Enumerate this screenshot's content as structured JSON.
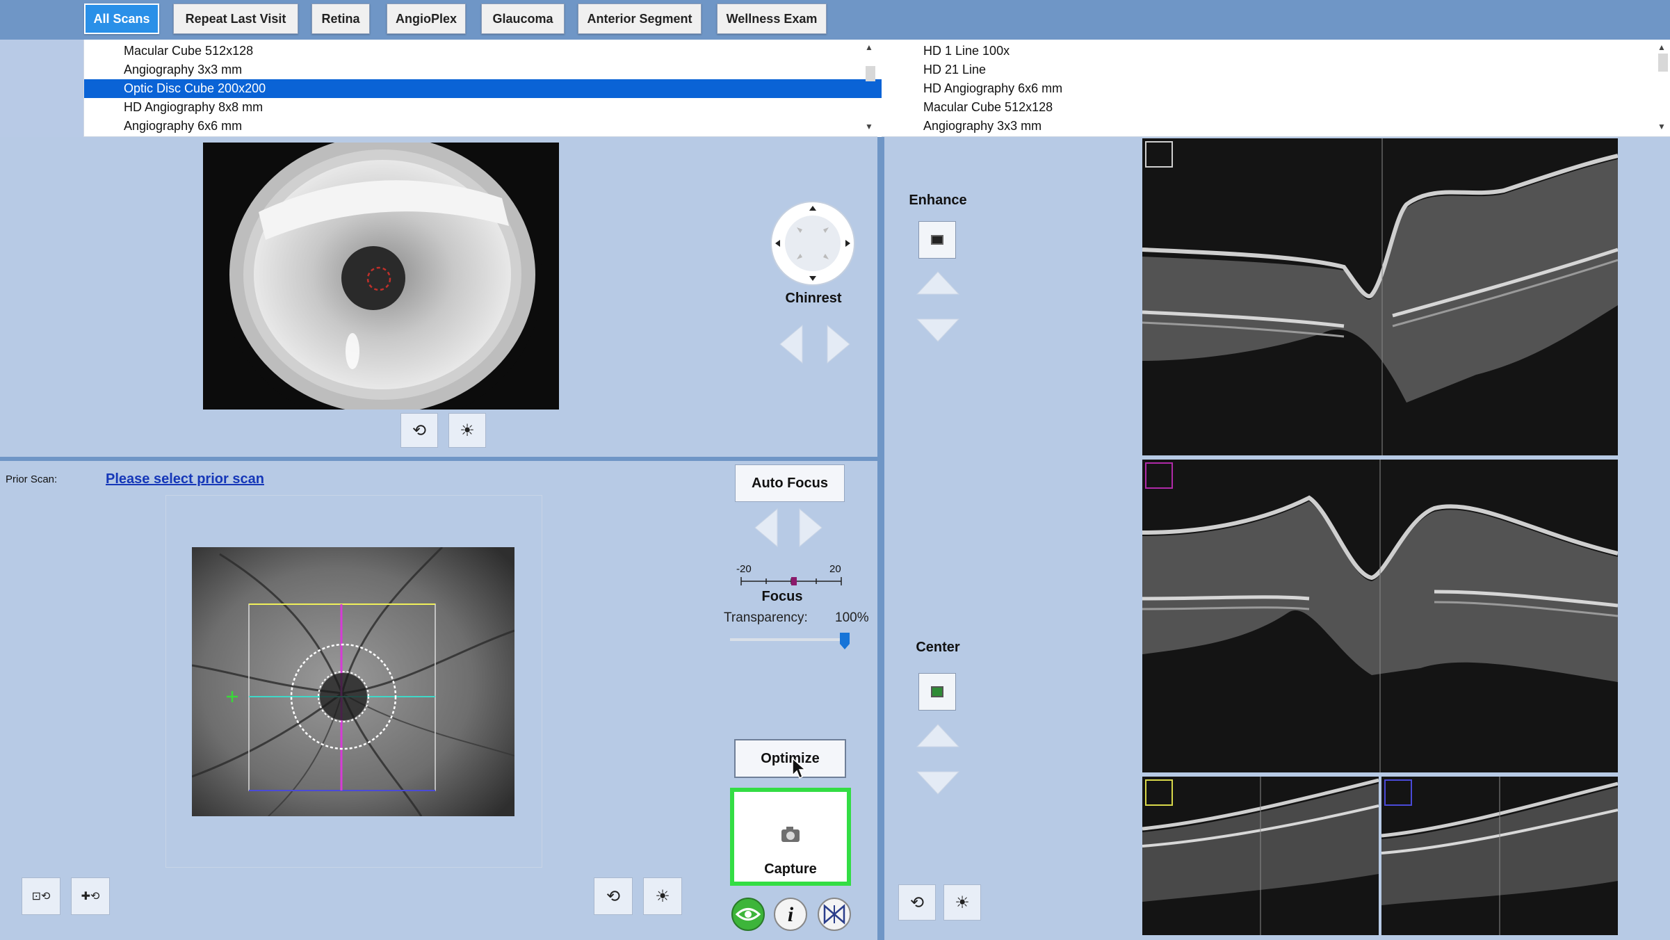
{
  "tabs": [
    {
      "label": "All Scans",
      "active": true
    },
    {
      "label": "Repeat Last Visit",
      "active": false
    },
    {
      "label": "Retina",
      "active": false
    },
    {
      "label": "AngioPlex",
      "active": false
    },
    {
      "label": "Glaucoma",
      "active": false
    },
    {
      "label": "Anterior Segment",
      "active": false
    },
    {
      "label": "Wellness Exam",
      "active": false
    }
  ],
  "left_list": {
    "items": [
      "Macular Cube 512x128",
      "Angiography 3x3 mm",
      "Optic Disc Cube 200x200",
      "HD Angiography 8x8 mm",
      "Angiography 6x6 mm"
    ],
    "selected": "Optic Disc Cube 200x200"
  },
  "right_list": {
    "items": [
      "HD 1 Line 100x",
      "HD 21 Line",
      "HD Angiography 6x6 mm",
      "Macular Cube 512x128",
      "Angiography 3x3 mm"
    ]
  },
  "iris_controls": {
    "chinrest_label": "Chinrest"
  },
  "prior_scan": {
    "label": "Prior Scan:",
    "link": "Please select prior scan"
  },
  "focus_panel": {
    "auto_focus_label": "Auto Focus",
    "focus_min": "-20",
    "focus_max": "20",
    "focus_label": "Focus",
    "transparency_label": "Transparency:",
    "transparency_value": "100%",
    "optimize_label": "Optimize",
    "capture_label": "Capture"
  },
  "oct_controls": {
    "enhance_label": "Enhance",
    "center_label": "Center"
  },
  "colors": {
    "topbar": "#6f96c6",
    "panel": "#b7cae5",
    "selection": "#0a63d6",
    "capture_border": "#33dd44"
  },
  "icons": [
    "undo-icon",
    "brightness-icon",
    "camera-icon",
    "eye-tracking-icon",
    "info-icon",
    "hourglass-icon"
  ]
}
